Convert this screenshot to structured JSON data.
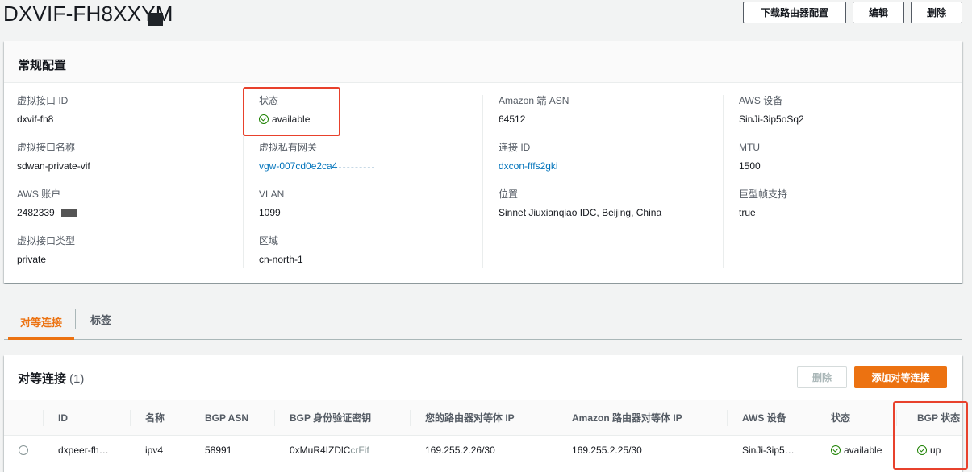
{
  "header": {
    "title": "DXVIF-FH8XXYM",
    "download_label": "下载路由器配置",
    "edit_label": "编辑",
    "delete_label": "删除"
  },
  "general": {
    "heading": "常规配置",
    "col1": [
      {
        "key": "虚拟接口 ID",
        "value": "dxvif-fh8"
      },
      {
        "key": "虚拟接口名称",
        "value": "sdwan-private-vif"
      },
      {
        "key": "AWS 账户",
        "value": "2482339"
      },
      {
        "key": "虚拟接口类型",
        "value": "private"
      }
    ],
    "col2": [
      {
        "key": "状态",
        "value": "available"
      },
      {
        "key": "虚拟私有网关",
        "value": "vgw-007cd0e2ca4"
      },
      {
        "key": "VLAN",
        "value": "1099"
      },
      {
        "key": "区域",
        "value": "cn-north-1"
      }
    ],
    "col3": [
      {
        "key": "Amazon 端 ASN",
        "value": "64512"
      },
      {
        "key": "连接 ID",
        "value": "dxcon-fffs2gki"
      },
      {
        "key": "位置",
        "value": "Sinnet Jiuxianqiao IDC, Beijing, China"
      }
    ],
    "col4": [
      {
        "key": "AWS 设备",
        "value": "SinJi-3ip5oSq2"
      },
      {
        "key": "MTU",
        "value": "1500"
      },
      {
        "key": "巨型帧支持",
        "value": "true"
      }
    ]
  },
  "tabs": {
    "peer": "对等连接",
    "tags": "标签"
  },
  "peers": {
    "title": "对等连接",
    "count": "(1)",
    "delete_label": "删除",
    "add_label": "添加对等连接",
    "columns": [
      "ID",
      "名称",
      "BGP ASN",
      "BGP 身份验证密钥",
      "您的路由器对等体 IP",
      "Amazon 路由器对等体 IP",
      "AWS 设备",
      "状态",
      "BGP 状态"
    ],
    "row": {
      "id": "dxpeer-fh…",
      "name": "ipv4",
      "asn": "58991",
      "key": "0xMuR4IZDlC",
      "key_tail": "crFif",
      "your_ip": "169.255.2.26/30",
      "amazon_ip": "169.255.2.25/30",
      "device": "SinJi-3ip5…",
      "status": "available",
      "bgp_status": "up"
    }
  },
  "colors": {
    "accent": "#ec7211",
    "success": "#1d8102",
    "link": "#0073bb",
    "highlight": "#e8412c"
  }
}
